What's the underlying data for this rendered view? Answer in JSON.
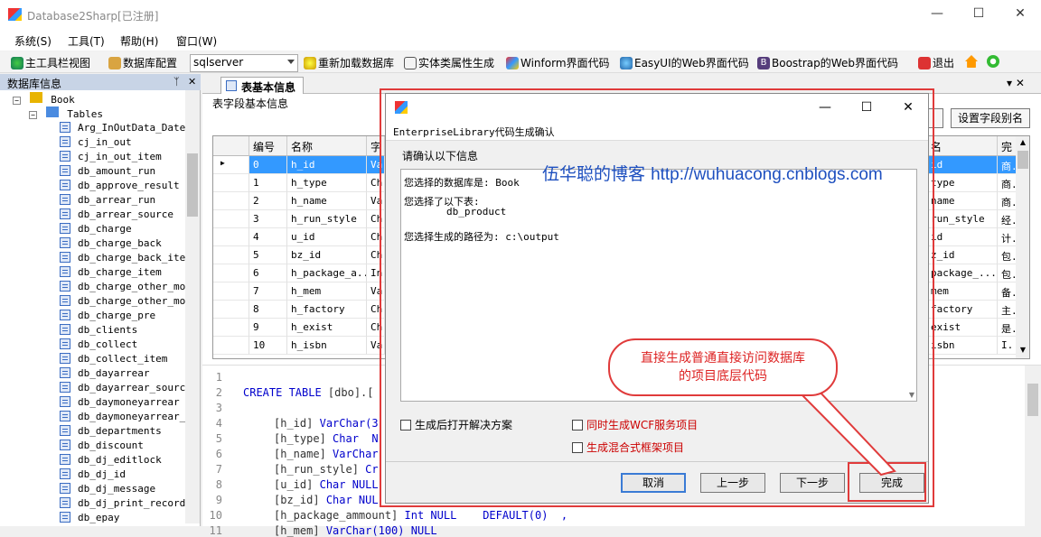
{
  "app": {
    "title": "Database2Sharp[已注册]"
  },
  "window_controls": {
    "minimize": "—",
    "maximize": "☐",
    "close": "✕"
  },
  "menu": [
    "系统(S)",
    "工具(T)",
    "帮助(H)",
    "窗口(W)"
  ],
  "toolbar": {
    "main_toolbar_view": "主工具栏视图",
    "db_config": "数据库配置",
    "db_type": "sqlserver",
    "reload_db": "重新加载数据库",
    "entity_gen": "实体类属性生成",
    "winform": "Winform界面代码",
    "easyui": "EasyUI的Web界面代码",
    "bootstrap": "Boostrap的Web界面代码",
    "exit": "退出"
  },
  "left_panel": {
    "title": "数据库信息",
    "pin": "ᛉ",
    "close": "✕",
    "root": "Book",
    "tables_node": "Tables",
    "tables": [
      "Arg_InOutData_Date",
      "cj_in_out",
      "cj_in_out_item",
      "db_amount_run",
      "db_approve_result",
      "db_arrear_run",
      "db_arrear_source",
      "db_charge",
      "db_charge_back",
      "db_charge_back_item",
      "db_charge_item",
      "db_charge_other_mone",
      "db_charge_other_mone",
      "db_charge_pre",
      "db_clients",
      "db_collect",
      "db_collect_item",
      "db_dayarrear",
      "db_dayarrear_source",
      "db_daymoneyarrear",
      "db_daymoneyarrear_sc",
      "db_departments",
      "db_discount",
      "db_dj_editlock",
      "db_dj_id",
      "db_dj_message",
      "db_dj_print_record",
      "db_epay"
    ]
  },
  "main": {
    "tab_label": "表基本信息",
    "tab_controls": "▾ ✕",
    "section_label": "表字段基本信息",
    "set_alias_button": "设置字段别名",
    "grid": {
      "headers": [
        "编号",
        "名称",
        "字",
        "名",
        "完"
      ],
      "rows": [
        {
          "no": "0",
          "name": "h_id",
          "t": "Va",
          "alias": "id",
          "c": "商."
        },
        {
          "no": "1",
          "name": "h_type",
          "t": "Ch",
          "alias": "type",
          "c": "商."
        },
        {
          "no": "2",
          "name": "h_name",
          "t": "Va",
          "alias": "name",
          "c": "商."
        },
        {
          "no": "3",
          "name": "h_run_style",
          "t": "Ch",
          "alias": "run_style",
          "c": "经."
        },
        {
          "no": "4",
          "name": "u_id",
          "t": "Ch",
          "alias": "id",
          "c": "计."
        },
        {
          "no": "5",
          "name": "bz_id",
          "t": "Ch",
          "alias": "z_id",
          "c": "包."
        },
        {
          "no": "6",
          "name": "h_package_a...",
          "t": "In",
          "alias": "package_...",
          "c": "包."
        },
        {
          "no": "7",
          "name": "h_mem",
          "t": "Va",
          "alias": "mem",
          "c": "备."
        },
        {
          "no": "8",
          "name": "h_factory",
          "t": "Ch",
          "alias": "factory",
          "c": "主."
        },
        {
          "no": "9",
          "name": "h_exist",
          "t": "Ch",
          "alias": "exist",
          "c": "是."
        },
        {
          "no": "10",
          "name": "h_isbn",
          "t": "Va",
          "alias": "isbn",
          "c": "I."
        }
      ]
    },
    "code": {
      "lines": [
        "1",
        "2",
        "3",
        "4",
        "5",
        "6",
        "7",
        "8",
        "9",
        "10",
        "11"
      ],
      "create": "CREATE TABLE",
      "create_rest": " [dbo].[",
      "fields": [
        {
          "name": "[h_id]",
          "type": "VarChar(3"
        },
        {
          "name": "[h_type]",
          "type": "Char  N"
        },
        {
          "name": "[h_name]",
          "type": "VarChar"
        },
        {
          "name": "[h_run_style]",
          "type": "Cr"
        },
        {
          "name": "[u_id]",
          "type": "Char NULL"
        },
        {
          "name": "[bz_id]",
          "type": "Char NUL"
        },
        {
          "name": "[h_package_ammount]",
          "type": "Int NULL    DEFAULT(0)  ,"
        },
        {
          "name": "[h_mem]",
          "type": "VarChar(100) NULL"
        }
      ]
    }
  },
  "dialog": {
    "heading": "EnterpriseLibrary代码生成确认",
    "confirm_label": "请确认以下信息",
    "info": {
      "db_line": "您选择的数据库是: Book",
      "tables_line": "您选择了以下表:",
      "table_item": "db_product",
      "path_line": "您选择生成的路径为: c:\\output"
    },
    "options": {
      "open_solution": "生成后打开解决方案",
      "wcf": "同时生成WCF服务项目",
      "hybrid": "生成混合式框架项目"
    },
    "buttons": {
      "cancel": "取消",
      "prev": "上一步",
      "next": "下一步",
      "finish": "完成"
    }
  },
  "overlays": {
    "watermark_name": "伍华聪的博客",
    "watermark_url": "http://wuhuacong.cnblogs.com",
    "callout_line1": "直接生成普通直接访问数据库",
    "callout_line2": "的项目底层代码"
  }
}
